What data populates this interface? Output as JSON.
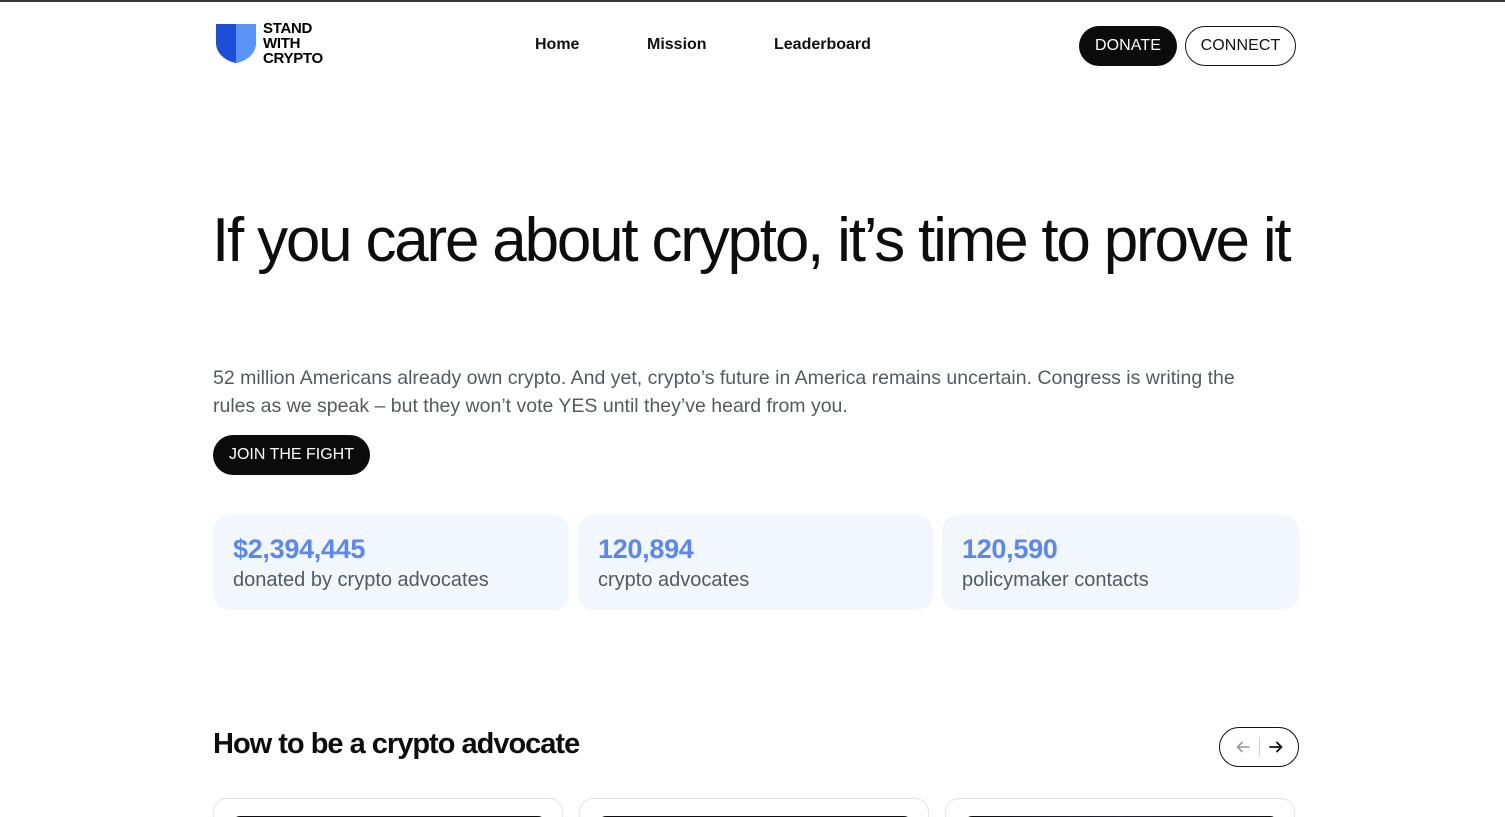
{
  "brand": {
    "logo_lines": [
      "STAND",
      "WITH",
      "CRYPTO"
    ],
    "shield_colors": [
      "#1d4ed8",
      "#4f8bf5"
    ]
  },
  "nav": {
    "items": [
      {
        "label": "Home"
      },
      {
        "label": "Mission"
      },
      {
        "label": "Leaderboard"
      }
    ],
    "donate_label": "DONATE",
    "connect_label": "CONNECT"
  },
  "hero": {
    "title": "If you care about crypto, it’s time to prove it",
    "subtitle": "52 million Americans already own crypto. And yet, crypto’s future in America remains uncertain. Congress is writing the rules as we speak – but they won’t vote YES until they’ve heard from you.",
    "cta_label": "JOIN THE FIGHT"
  },
  "stats": [
    {
      "value": "$2,394,445",
      "label": "donated by crypto advocates"
    },
    {
      "value": "120,894",
      "label": "crypto advocates"
    },
    {
      "value": "120,590",
      "label": "policymaker contacts"
    }
  ],
  "advocate_section": {
    "title": "How to be a crypto advocate",
    "prev_icon": "arrow-left-icon",
    "next_icon": "arrow-right-icon"
  },
  "colors": {
    "accent": "#5b87f2",
    "stat_bg": "#f2f6fd",
    "button_dark": "#0b0b0b"
  }
}
